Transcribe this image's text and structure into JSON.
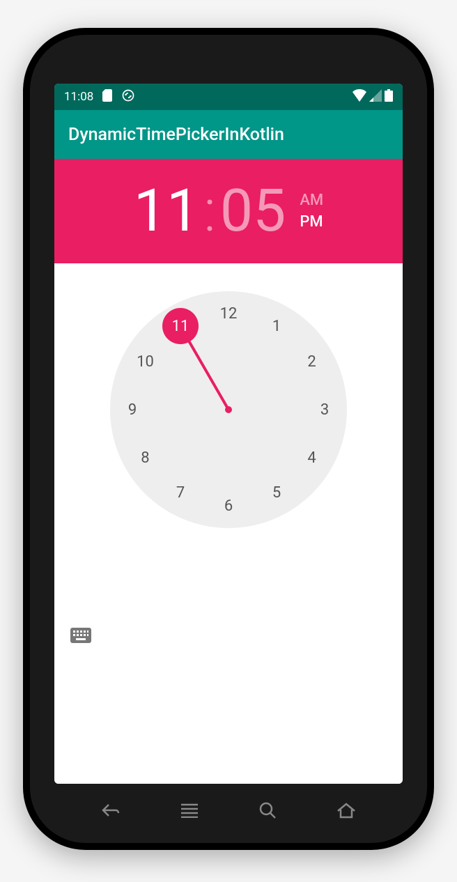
{
  "statusbar": {
    "time": "11:08"
  },
  "appbar": {
    "title": "DynamicTimePickerInKotlin"
  },
  "timepicker": {
    "hour": "11",
    "minute": "05",
    "am_label": "AM",
    "pm_label": "PM",
    "am_selected": false,
    "selected_hour": 11
  },
  "clock": {
    "hours": [
      "12",
      "1",
      "2",
      "3",
      "4",
      "5",
      "6",
      "7",
      "8",
      "9",
      "10",
      "11"
    ]
  }
}
